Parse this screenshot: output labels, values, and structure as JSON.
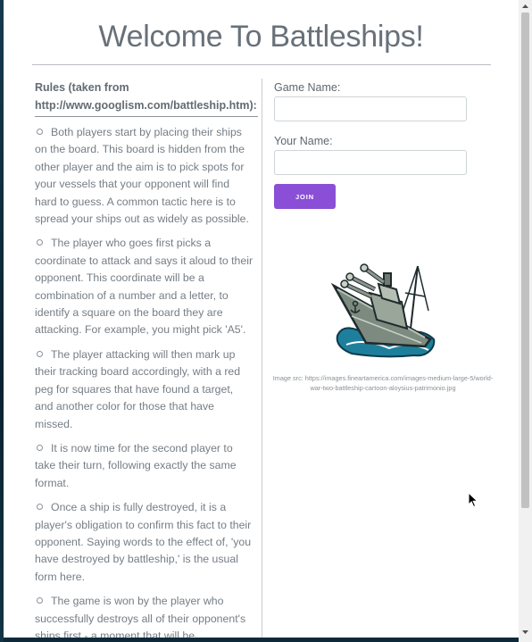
{
  "page": {
    "title": "Welcome To Battleships!"
  },
  "rules": {
    "heading_line1": "Rules (taken from",
    "heading_line2": "http://www.googlism.com/battleship.htm):",
    "items": [
      "Both players start by placing their ships on the board. This board is hidden from the other player and the aim is to pick spots for your vessels that your opponent will find hard to guess. A common tactic here is to spread your ships out as widely as possible.",
      "The player who goes first picks a coordinate to attack and says it aloud to their opponent. This coordinate will be a combination of a number and a letter, to identify a square on the board they are attacking. For example, you might pick 'A5'.",
      "The player attacking will then mark up their tracking board accordingly, with a red peg for squares that have found a target, and another color for those that have missed.",
      "It is now time for the second player to take their turn, following exactly the same format.",
      "Once a ship is fully destroyed, it is a player's obligation to confirm this fact to their opponent. Saying words to the effect of, 'you have destroyed by battleship,' is the usual form here.",
      "The game is won by the player who successfully destroys all of their opponent's ships first - a moment that will be"
    ]
  },
  "form": {
    "game_name_label": "Game Name:",
    "game_name_value": "",
    "your_name_label": "Your Name:",
    "your_name_value": "",
    "join_label": "JOIN"
  },
  "image": {
    "icon": "battleship-cartoon-icon",
    "caption": "Image src: https://images.fineartamerica.com/images-medium-large-5/world-war-two-battleship-cartoon-aloysius-patrimonio.jpg"
  },
  "colors": {
    "join_button": "#8a4fd6",
    "title_text": "#68717a",
    "body_text": "#757d85"
  }
}
